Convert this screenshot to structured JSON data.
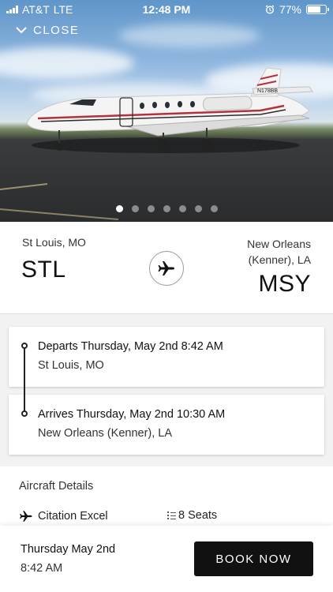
{
  "status_bar": {
    "carrier": "AT&T",
    "network": "LTE",
    "time": "12:48 PM",
    "battery": "77%",
    "battery_level": 0.77,
    "icons": [
      "signal-icon",
      "alarm-icon",
      "battery-icon"
    ]
  },
  "header": {
    "close_label": "CLOSE"
  },
  "gallery": {
    "image_count": 7,
    "active_index": 0,
    "aircraft_tail_number": "N178BB"
  },
  "route": {
    "origin_city": "St Louis, MO",
    "origin_code": "STL",
    "destination_city": "New Orleans (Kenner), LA",
    "destination_code": "MSY"
  },
  "timeline": {
    "departure_title": "Departs Thursday, May 2nd 8:42 AM",
    "departure_location": "St Louis, MO",
    "arrival_title": "Arrives Thursday, May 2nd 10:30 AM",
    "arrival_location": "New Orleans (Kenner), LA"
  },
  "aircraft": {
    "section_title": "Aircraft Details",
    "model": "Citation Excel",
    "seats": "8 Seats"
  },
  "footer": {
    "date": "Thursday May 2nd",
    "time": "8:42 AM",
    "book_label": "BOOK NOW"
  },
  "colors": {
    "button_bg": "#111111",
    "accent_stripe": "#b5303d"
  }
}
